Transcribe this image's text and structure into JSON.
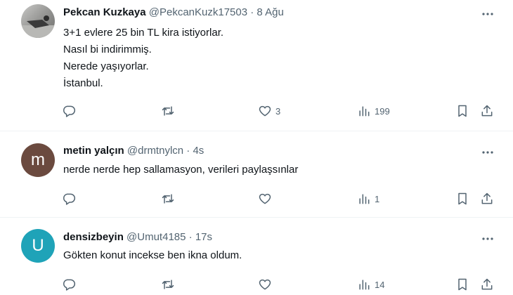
{
  "tweets": [
    {
      "name": "Pekcan Kuzkaya",
      "handle": "@PekcanKuzk17503",
      "separator": "·",
      "time": "8 Ağu",
      "body": "3+1 evlere 25 bin TL kira istiyorlar.\nNasıl bi indirimmiş.\nNerede yaşıyorlar.\nİstanbul.",
      "likes": "3",
      "views": "199"
    },
    {
      "name": "metin yalçın",
      "handle": "@drmtnylcn",
      "separator": "·",
      "time": "4s",
      "avatar_letter": "m",
      "avatar_color": "#6b4a3f",
      "body": "nerde nerde hep sallamasyon, verileri paylaşsınlar",
      "views": "1"
    },
    {
      "name": "densizbeyin",
      "handle": "@Umut4185",
      "separator": "·",
      "time": "17s",
      "avatar_letter": "U",
      "avatar_color": "#1fa3b8",
      "body": "Gökten konut incekse ben ikna oldum.",
      "views": "14"
    }
  ],
  "icons": {
    "more": "more-icon",
    "reply": "reply-icon",
    "retweet": "retweet-icon",
    "like": "like-icon",
    "views": "views-icon",
    "bookmark": "bookmark-icon",
    "share": "share-icon"
  },
  "colors": {
    "text": "#0f1419",
    "secondary": "#536471",
    "divider": "#eff3f4"
  }
}
